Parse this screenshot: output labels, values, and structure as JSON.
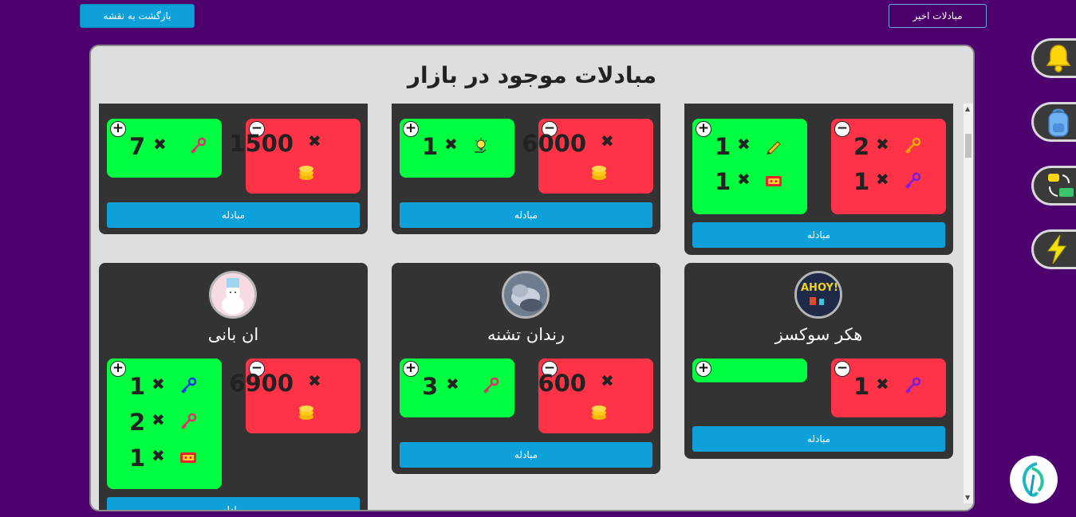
{
  "header": {
    "back_label": "بازگشت به نقشه",
    "recent_label": "مبادلات اخیر"
  },
  "modal": {
    "title": "مبادلات موجود در بازار"
  },
  "trade_label": "مبادله",
  "colors": {
    "background": "#4e006e",
    "give": "#fe3347",
    "get": "#00ff40",
    "button": "#0ea0d8",
    "card": "#333333"
  },
  "side_icons": [
    "bell-icon",
    "backpack-icon",
    "exchange-icon",
    "lightning-icon"
  ],
  "cards": [
    {
      "username": "",
      "give": [
        {
          "qty": "1500",
          "item": "coins-icon"
        }
      ],
      "get": [
        {
          "qty": "7",
          "item": "red-key-icon"
        }
      ]
    },
    {
      "username": "",
      "give": [
        {
          "qty": "6000",
          "item": "coins-icon"
        }
      ],
      "get": [
        {
          "qty": "1",
          "item": "idea-bulb-icon"
        }
      ]
    },
    {
      "username": "",
      "give": [
        {
          "qty": "2",
          "item": "gold-key-icon"
        },
        {
          "qty": "1",
          "item": "purple-key-icon"
        }
      ],
      "get": [
        {
          "qty": "1",
          "item": "pencil-icon"
        },
        {
          "qty": "1",
          "item": "ticket-icon"
        }
      ]
    },
    {
      "username": "ان بانی",
      "avatar": "bear-avatar",
      "give": [
        {
          "qty": "6900",
          "item": "coins-icon"
        }
      ],
      "get": [
        {
          "qty": "1",
          "item": "blue-key-icon"
        },
        {
          "qty": "2",
          "item": "red-key-icon"
        },
        {
          "qty": "1",
          "item": "ticket-icon"
        }
      ]
    },
    {
      "username": "رندان تشنه",
      "avatar": "sky-avatar",
      "give": [
        {
          "qty": "600",
          "item": "coins-icon"
        }
      ],
      "get": [
        {
          "qty": "3",
          "item": "red-key-icon"
        }
      ]
    },
    {
      "username": "هکر سوکسز",
      "avatar": "ahoy-avatar",
      "give": [
        {
          "qty": "1",
          "item": "purple-key-icon"
        }
      ],
      "get": []
    }
  ]
}
